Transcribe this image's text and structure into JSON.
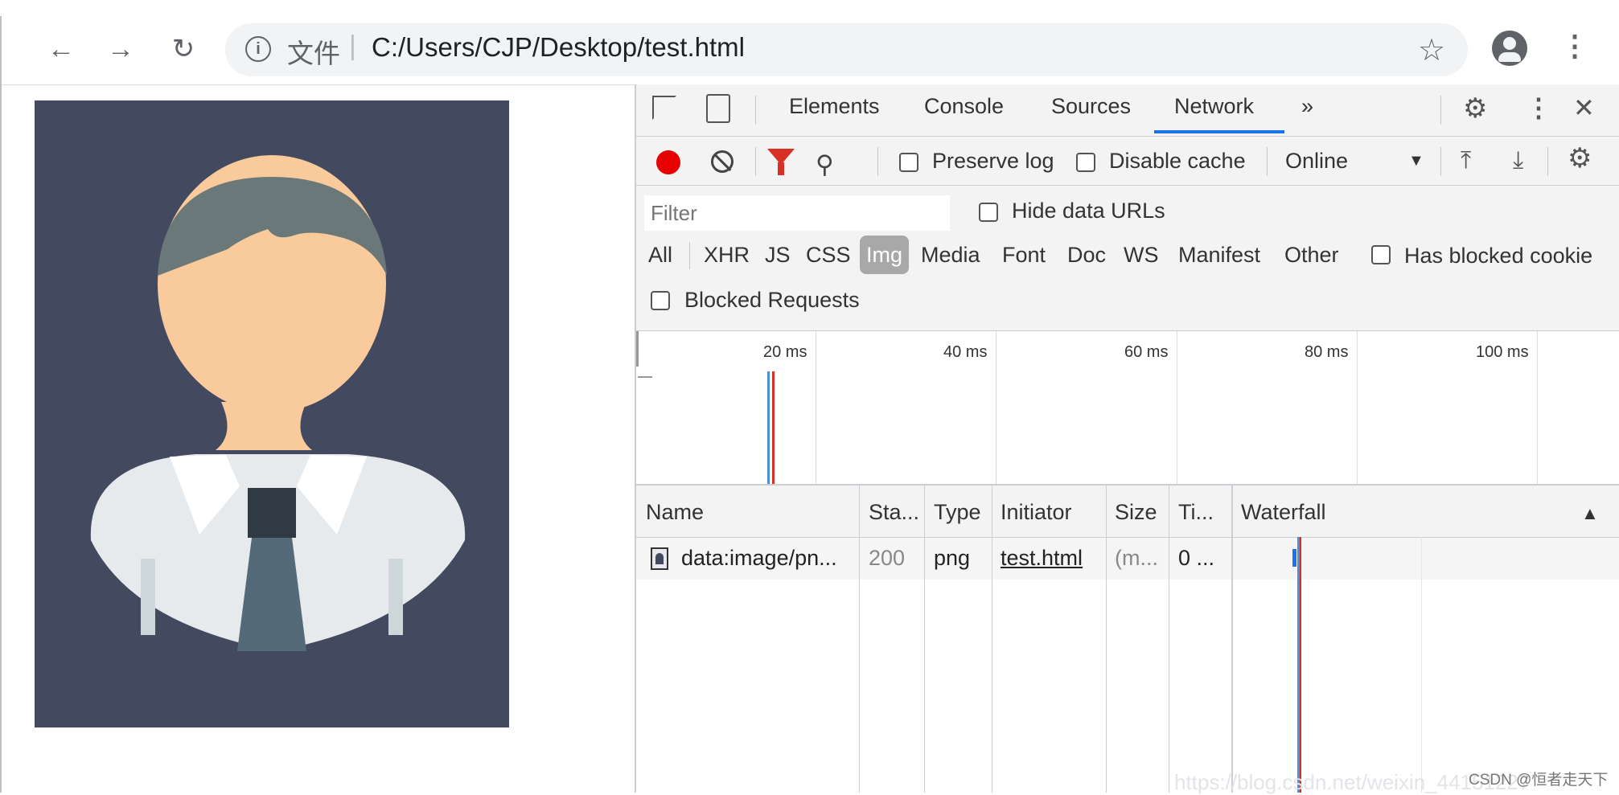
{
  "browser": {
    "url_scheme_label": "文件",
    "url_separator": "|",
    "url": "C:/Users/CJP/Desktop/test.html",
    "icons": [
      "back-arrow-icon",
      "forward-arrow-icon",
      "reload-icon",
      "info-icon",
      "star-icon",
      "account-icon",
      "kebab-menu-icon"
    ]
  },
  "page": {
    "image_alt": "avatar-illustration",
    "colors": {
      "background": "#434a5f",
      "hair": "#6b7879",
      "skin": "#f9ca9c",
      "shirt": "#e6eaec",
      "tie": "#546a78",
      "knot": "#2f3a45"
    }
  },
  "devtools": {
    "tabs": [
      {
        "label": "Elements"
      },
      {
        "label": "Console"
      },
      {
        "label": "Sources"
      },
      {
        "label": "Network",
        "active": true
      },
      {
        "label": "»"
      }
    ],
    "toolbar": {
      "preserve_log": "Preserve log",
      "disable_cache": "Disable cache",
      "throttling": "Online",
      "throttle_arrow": "▼"
    },
    "filter": {
      "placeholder": "Filter",
      "hide_data_urls": "Hide data URLs",
      "types": [
        "All",
        "XHR",
        "JS",
        "CSS",
        "Img",
        "Media",
        "Font",
        "Doc",
        "WS",
        "Manifest",
        "Other"
      ],
      "active_type": "Img",
      "has_blocked_cookies": "Has blocked cookie",
      "blocked_requests": "Blocked Requests"
    },
    "overview": {
      "ticks": [
        "20 ms",
        "40 ms",
        "60 ms",
        "80 ms",
        "100 ms"
      ]
    },
    "table": {
      "columns": [
        "Name",
        "Sta...",
        "Type",
        "Initiator",
        "Size",
        "Ti...",
        "Waterfall"
      ],
      "sort_indicator": "▲",
      "rows": [
        {
          "name": "data:image/pn...",
          "status": "200",
          "type": "png",
          "initiator": "test.html",
          "size": "(m...",
          "time": "0 ..."
        }
      ]
    },
    "accent_color": "#1a73e8",
    "record_color": "#e60000"
  },
  "watermark": {
    "url": "https://blog.csdn.net/weixin_44151227",
    "credit": "CSDN @恒者走天下"
  }
}
